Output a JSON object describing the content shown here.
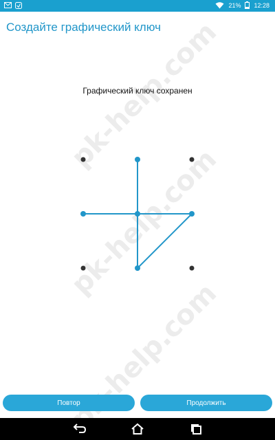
{
  "status_bar": {
    "battery": "21%",
    "time": "12:28",
    "icons": [
      "mail-icon",
      "notification-icon",
      "wifi-icon",
      "battery-icon"
    ]
  },
  "header": {
    "title": "Создайте графический ключ"
  },
  "pattern": {
    "message": "Графический ключ сохранен",
    "accent_color": "#2196c9",
    "dot_color": "#333333",
    "selected_dots": [
      1,
      4,
      7,
      5,
      3
    ]
  },
  "buttons": {
    "retry_label": "Повтор",
    "continue_label": "Продолжить"
  },
  "watermark": "pk-help.com",
  "nav": {
    "back": "back-icon",
    "home": "home-icon",
    "recents": "recents-icon"
  }
}
